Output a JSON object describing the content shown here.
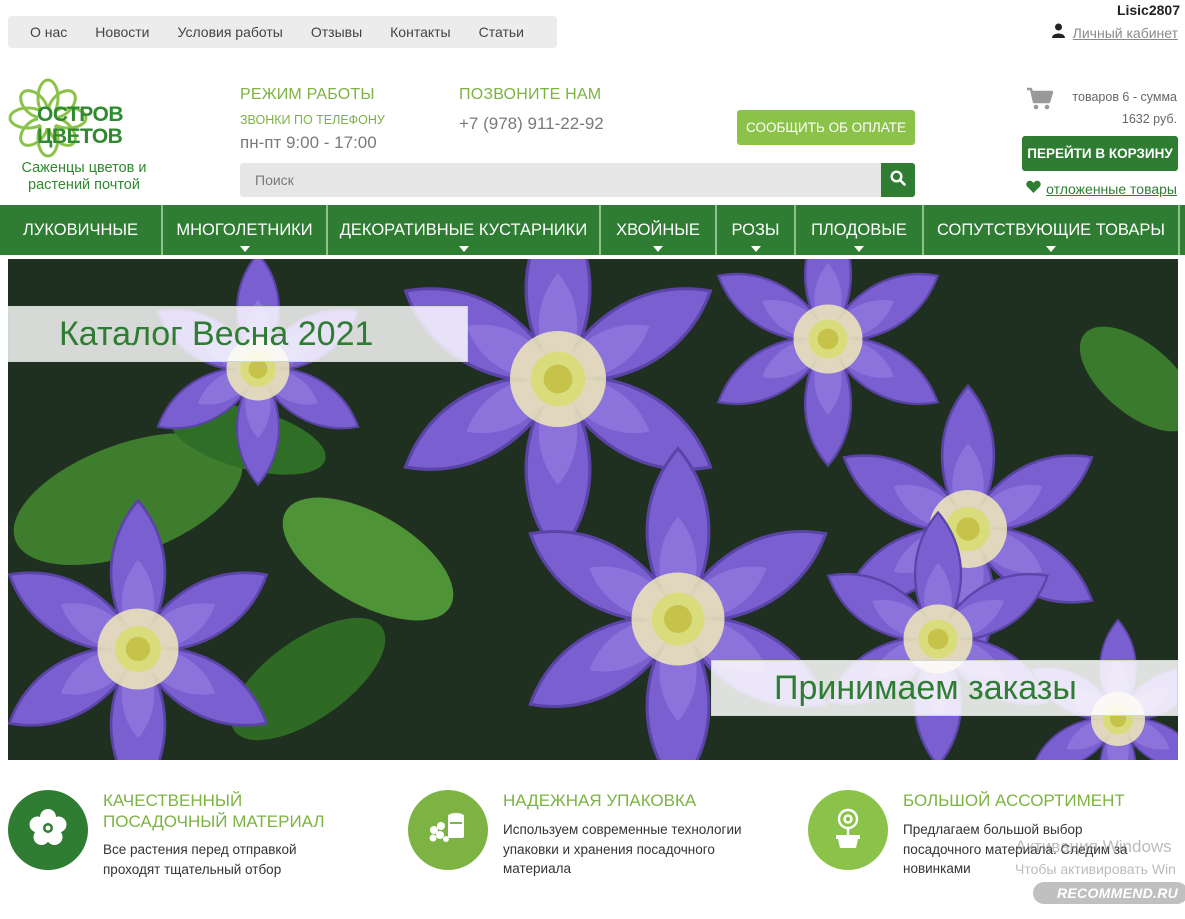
{
  "top_nav": {
    "items": [
      {
        "label": "О нас"
      },
      {
        "label": "Новости"
      },
      {
        "label": "Условия работы"
      },
      {
        "label": "Отзывы"
      },
      {
        "label": "Контакты"
      },
      {
        "label": "Статьи"
      }
    ]
  },
  "account": {
    "username": "Lisic2807",
    "cabinet_label": "Личный кабинет",
    "icon": "user-icon"
  },
  "logo": {
    "line1": "ОСТРОВ",
    "line2": "ЦВЕТОВ",
    "tagline_line1": "Саженцы цветов и",
    "tagline_line2": "растений почтой"
  },
  "work_hours": {
    "title": "РЕЖИМ РАБОТЫ",
    "subtitle": "ЗВОНКИ ПО ТЕЛЕФОНУ",
    "value": "пн-пт 9:00 - 17:00"
  },
  "call": {
    "title": "ПОЗВОНИТЕ НАМ",
    "phone": "+7 (978) 911-22-92"
  },
  "payment_button": "СООБЩИТЬ ОБ ОПЛАТЕ",
  "search": {
    "placeholder": "Поиск",
    "icon": "search-icon"
  },
  "cart": {
    "summary_line1": "товаров 6 - сумма",
    "summary_line2": "1632 руб.",
    "button": "ПЕРЕЙТИ В КОРЗИНУ",
    "wishlist": "отложенные товары",
    "icon": "cart-icon"
  },
  "categories": [
    {
      "label": "ЛУКОВИЧНЫЕ",
      "has_dropdown": false
    },
    {
      "label": "МНОГОЛЕТНИКИ",
      "has_dropdown": true
    },
    {
      "label": "ДЕКОРАТИВНЫЕ КУСТАРНИКИ",
      "has_dropdown": true
    },
    {
      "label": "ХВОЙНЫЕ",
      "has_dropdown": true
    },
    {
      "label": "РОЗЫ",
      "has_dropdown": true
    },
    {
      "label": "ПЛОДОВЫЕ",
      "has_dropdown": true
    },
    {
      "label": "СОПУТСТВУЮЩИЕ ТОВАРЫ",
      "has_dropdown": true
    }
  ],
  "banner": {
    "label_top": "Каталог Весна 2021",
    "label_bottom": "Принимаем заказы"
  },
  "features": [
    {
      "title_line1": "КАЧЕСТВЕННЫЙ",
      "title_line2": "ПОСАДОЧНЫЙ МАТЕРИАЛ",
      "text_line1": "Все растения перед отправкой",
      "text_line2": "проходят тщательный отбор",
      "text_line3": "",
      "icon": "flower-icon",
      "color": "#2e7d32"
    },
    {
      "title_line1": "НАДЕЖНАЯ УПАКОВКА",
      "title_line2": "",
      "text_line1": "Используем современные технологии",
      "text_line2": "упаковки и хранения посадочного",
      "text_line3": "материала",
      "icon": "package-icon",
      "color": "#7cb342"
    },
    {
      "title_line1": "БОЛЬШОЙ АССОРТИМЕНТ",
      "title_line2": "",
      "text_line1": "Предлагаем большой выбор",
      "text_line2": "посадочного материала. Следим за",
      "text_line3": "новинками",
      "icon": "potted-plant-icon",
      "color": "#8bc34a"
    }
  ],
  "overlays": {
    "windows_line1": "Активация Windows",
    "windows_line2": "Чтобы активировать Win",
    "recommend": "RECOMMEND.RU"
  },
  "colors": {
    "brand_dark_green": "#2e7d32",
    "brand_light_green": "#8bc34a",
    "accent_text_green": "#7cb342"
  }
}
